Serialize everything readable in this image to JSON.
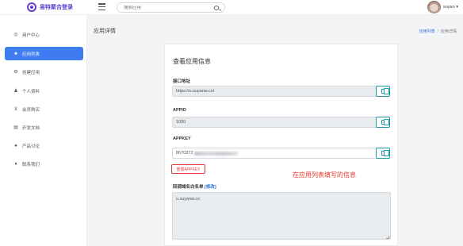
{
  "header": {
    "brand": "易特聚合登录",
    "search_placeholder": "搜索应用",
    "user_name": "suyan"
  },
  "sidebar": {
    "items": [
      {
        "label": "用户中心",
        "icon": "user-center-icon",
        "active": false
      },
      {
        "label": "应用列表",
        "icon": "app-list-icon",
        "active": true
      },
      {
        "label": "创建应用",
        "icon": "create-app-icon",
        "active": false
      },
      {
        "label": "个人资料",
        "icon": "profile-icon",
        "active": false
      },
      {
        "label": "会员购买",
        "icon": "cart-icon",
        "active": false
      },
      {
        "label": "开发文档",
        "icon": "doc-icon",
        "active": false
      },
      {
        "label": "产品讨论",
        "icon": "discussion-icon",
        "active": false
      },
      {
        "label": "联系我们",
        "icon": "contact-icon",
        "active": false
      }
    ]
  },
  "main": {
    "title": "应用详情",
    "breadcrumb": {
      "parent": "应用列表",
      "separator": "/",
      "current": "应用详情"
    }
  },
  "card": {
    "title": "查看应用信息",
    "api_label": "接口地址",
    "api_value": "https://u.suyanw.cn/",
    "appid_label": "APPID",
    "appid_value": "1000",
    "appkey_label": "APPKEY",
    "appkey_value_prefix": "8670372",
    "reset_label": "重置APPKEY",
    "callback_label": "回调域名白名单",
    "edit_label": "[修改]",
    "callback_value": "u.suyanw.cn",
    "annotation": "在应用列表填写的信息"
  },
  "colors": {
    "accent": "#3f7cf2",
    "brand": "#6a3fd6",
    "danger": "#e23b3b",
    "copy": "#1e9aa8"
  }
}
